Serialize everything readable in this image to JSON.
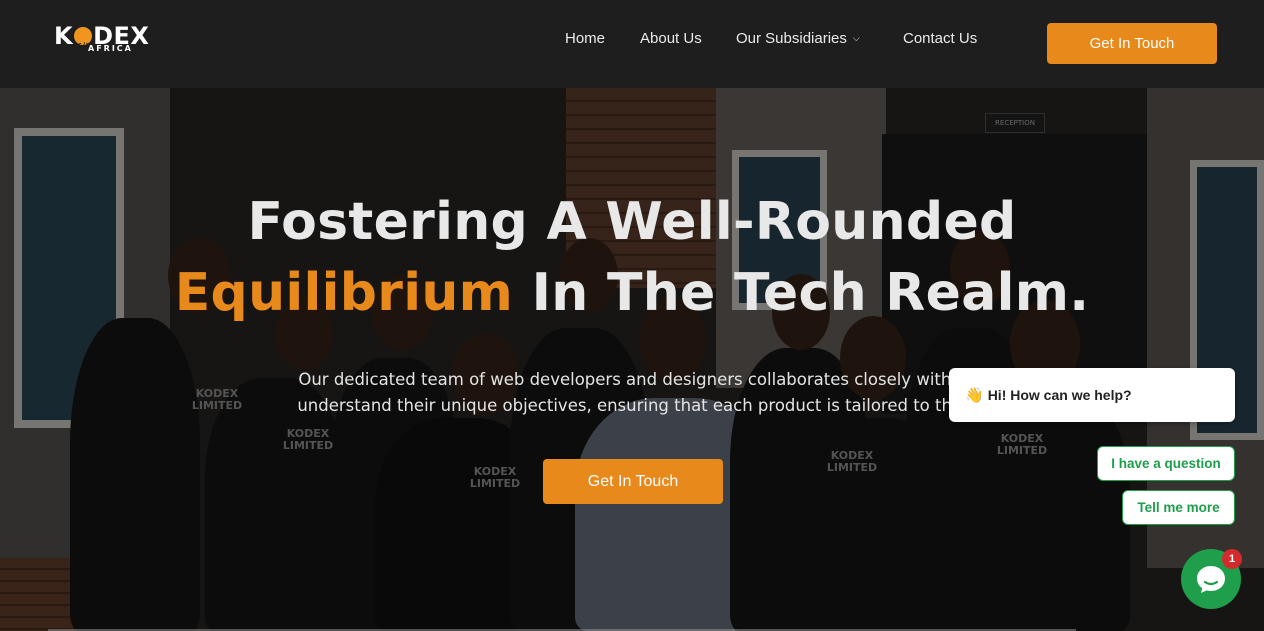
{
  "brand": {
    "name": "KODEX",
    "sub": "AFRICA"
  },
  "nav": {
    "items": [
      {
        "label": "Home"
      },
      {
        "label": "About Us"
      },
      {
        "label": "Our Subsidiaries"
      },
      {
        "label": "Contact Us"
      }
    ],
    "cta_label": "Get In Touch"
  },
  "hero": {
    "title_line1": "Fostering A Well-Rounded",
    "title_accent": "Equilibrium",
    "title_line2_rest": " In The Tech Realm.",
    "text_line1": "Our dedicated team of web developers and designers collaborates closely with c",
    "text_line2": "understand their unique objectives, ensuring that each product is tailored to thei",
    "cta_label": "Get In Touch",
    "sign_text": "RECEPTION"
  },
  "chat": {
    "greeting": "Hi! How can we help?",
    "options": [
      "I have a question",
      "Tell me more"
    ],
    "badge_count": "1"
  },
  "colors": {
    "accent": "#e8891c",
    "header_bg": "#1e1e1e",
    "chat_green": "#1f9e4b",
    "badge_red": "#d32b2b"
  },
  "icons": [
    "chevron-down-icon",
    "waving-hand-icon",
    "chat-icon"
  ]
}
